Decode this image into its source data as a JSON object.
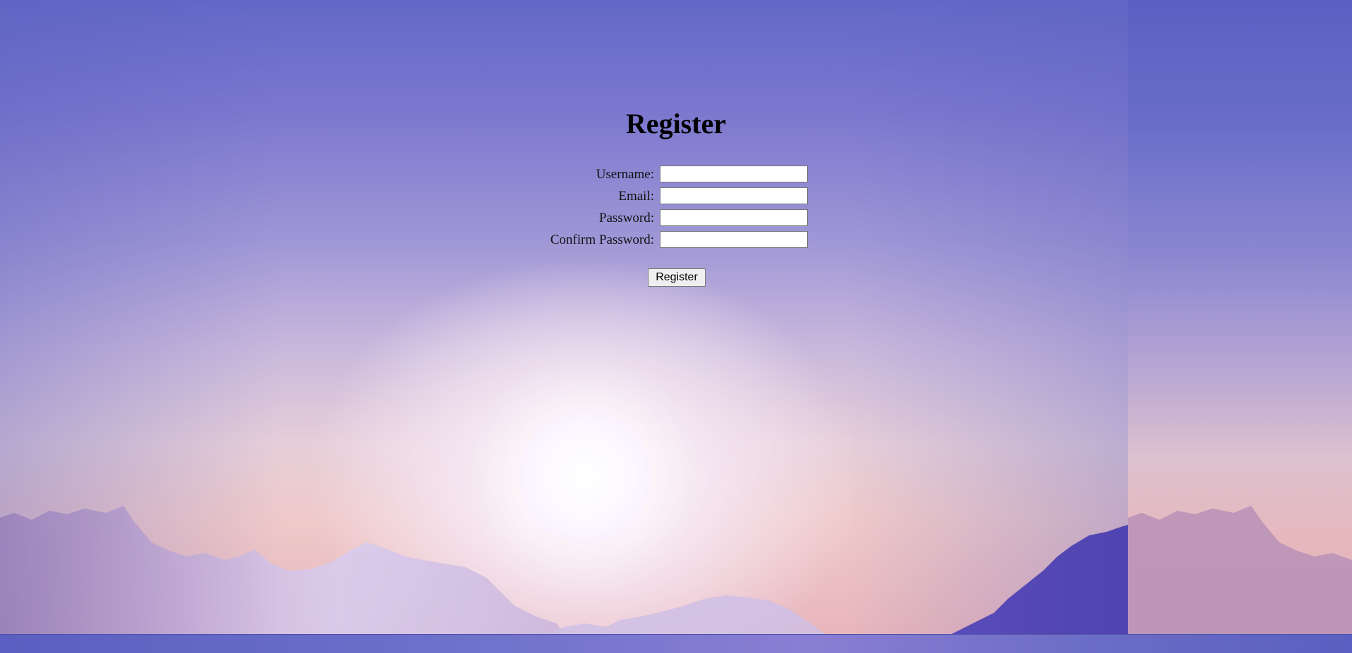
{
  "page": {
    "title": "Register"
  },
  "form": {
    "fields": [
      {
        "label": "Username:",
        "value": "",
        "placeholder": ""
      },
      {
        "label": "Email:",
        "value": "",
        "placeholder": ""
      },
      {
        "label": "Password:",
        "value": "",
        "placeholder": ""
      },
      {
        "label": "Confirm Password:",
        "value": "",
        "placeholder": ""
      }
    ],
    "submit_label": "Register"
  },
  "theme": {
    "sky_top": "#6368c8",
    "sky_bottom": "#e8b6bc",
    "mountain_near": "#4f3fb0",
    "mountain_far": "#c6b3dc",
    "bottom_band": "#6f72cb"
  }
}
